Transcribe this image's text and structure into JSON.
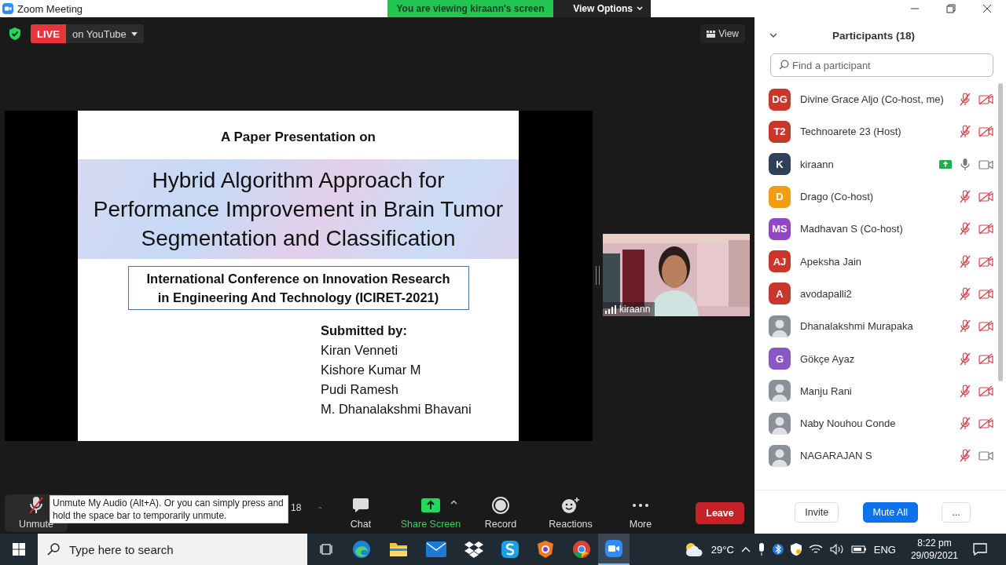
{
  "window": {
    "title": "Zoom Meeting"
  },
  "share_banner": {
    "text": "You are viewing kiraann's screen",
    "view_options": "View Options"
  },
  "live": {
    "badge": "LIVE",
    "platform": "on YouTube"
  },
  "view_button": "View",
  "slide": {
    "heading": "A Paper Presentation on",
    "title_lines": [
      "Hybrid Algorithm Approach for",
      "Performance Improvement in Brain Tumor",
      "Segmentation and Classification"
    ],
    "conference_lines": [
      "International Conference on Innovation Research",
      "in Engineering And Technology (ICIRET-2021)"
    ],
    "submitted_label": "Submitted by:",
    "authors": [
      "Kiran Venneti",
      "Kishore Kumar M",
      "Pudi Ramesh",
      "M. Dhanalakshmi Bhavani"
    ]
  },
  "video_tile": {
    "kind": "picture",
    "name": "kiraann"
  },
  "toolbar": {
    "tooltip": "Unmute My Audio (Alt+A). Or you can simply press and hold the space bar to temporarily unmute.",
    "items": [
      {
        "kind": "mic-muted",
        "label": "Unmute"
      },
      {
        "kind": "participants",
        "count": "18"
      },
      {
        "kind": "chat",
        "label": "Chat"
      },
      {
        "kind": "share",
        "label": "Share Screen"
      },
      {
        "kind": "record",
        "label": "Record"
      },
      {
        "kind": "reactions",
        "label": "Reactions"
      },
      {
        "kind": "more",
        "label": "More"
      }
    ],
    "leave": "Leave"
  },
  "participants": {
    "title": "Participants (18)",
    "search_placeholder": "Find a participant",
    "items": [
      {
        "name": "Divine Grace Aljo (Co-host, me)",
        "kind": "initials",
        "initials": "DG",
        "color": "#c9372c",
        "sharing": false,
        "muted": true,
        "video_off": true
      },
      {
        "name": "Technoarete 23 (Host)",
        "kind": "initials",
        "initials": "T2",
        "color": "#c9372c",
        "sharing": false,
        "muted": true,
        "video_off": true
      },
      {
        "name": "kiraann",
        "kind": "initials",
        "initials": "K",
        "color": "#2e4159",
        "sharing": true,
        "muted": false,
        "video_off": false
      },
      {
        "name": "Drago (Co-host)",
        "kind": "initials",
        "initials": "D",
        "color": "#f29d12",
        "sharing": false,
        "muted": true,
        "video_off": true
      },
      {
        "name": "Madhavan S (Co-host)",
        "kind": "initials",
        "initials": "MS",
        "color": "#9146c3",
        "sharing": false,
        "muted": true,
        "video_off": true
      },
      {
        "name": "Apeksha Jain",
        "kind": "initials",
        "initials": "AJ",
        "color": "#c9372c",
        "sharing": false,
        "muted": true,
        "video_off": true
      },
      {
        "name": "avodapalli2",
        "kind": "initials",
        "initials": "A",
        "color": "#c9372c",
        "sharing": false,
        "muted": true,
        "video_off": true
      },
      {
        "name": "Dhanalakshmi Murapaka",
        "sharing": false,
        "muted": true,
        "video_off": true
      },
      {
        "name": "Gökçe Ayaz",
        "kind": "initials",
        "initials": "G",
        "color": "#8b57c6",
        "sharing": false,
        "muted": true,
        "video_off": true
      },
      {
        "name": "Manju Rani",
        "sharing": false,
        "muted": true,
        "video_off": true
      },
      {
        "name": "Naby Nouhou Conde",
        "sharing": false,
        "muted": true,
        "video_off": true
      },
      {
        "name": "NAGARAJAN S",
        "sharing": false,
        "muted": true,
        "video_off": false
      }
    ]
  },
  "panel_buttons": [
    {
      "label": "Invite",
      "primary": false
    },
    {
      "label": "Mute All",
      "primary": true
    },
    {
      "label": "...",
      "primary": false
    }
  ],
  "taskbar": {
    "search_placeholder": "Type here to search",
    "weather": "29°C",
    "language": "ENG",
    "time": "8:22 pm",
    "date": "29/09/2021"
  }
}
